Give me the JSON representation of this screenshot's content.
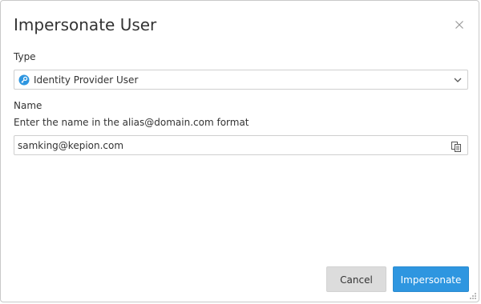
{
  "dialog": {
    "title": "Impersonate User",
    "close_icon": "close-icon"
  },
  "type_field": {
    "label": "Type",
    "selected_value": "Identity Provider User",
    "icon": "identity-provider-icon",
    "icon_color": "#2e96e0"
  },
  "name_field": {
    "label": "Name",
    "helper": "Enter the name in the alias@domain.com format",
    "value": "samking@kepion.com",
    "action_icon": "copy-icon"
  },
  "footer": {
    "cancel_label": "Cancel",
    "primary_label": "Impersonate",
    "primary_color": "#2e96e0"
  }
}
